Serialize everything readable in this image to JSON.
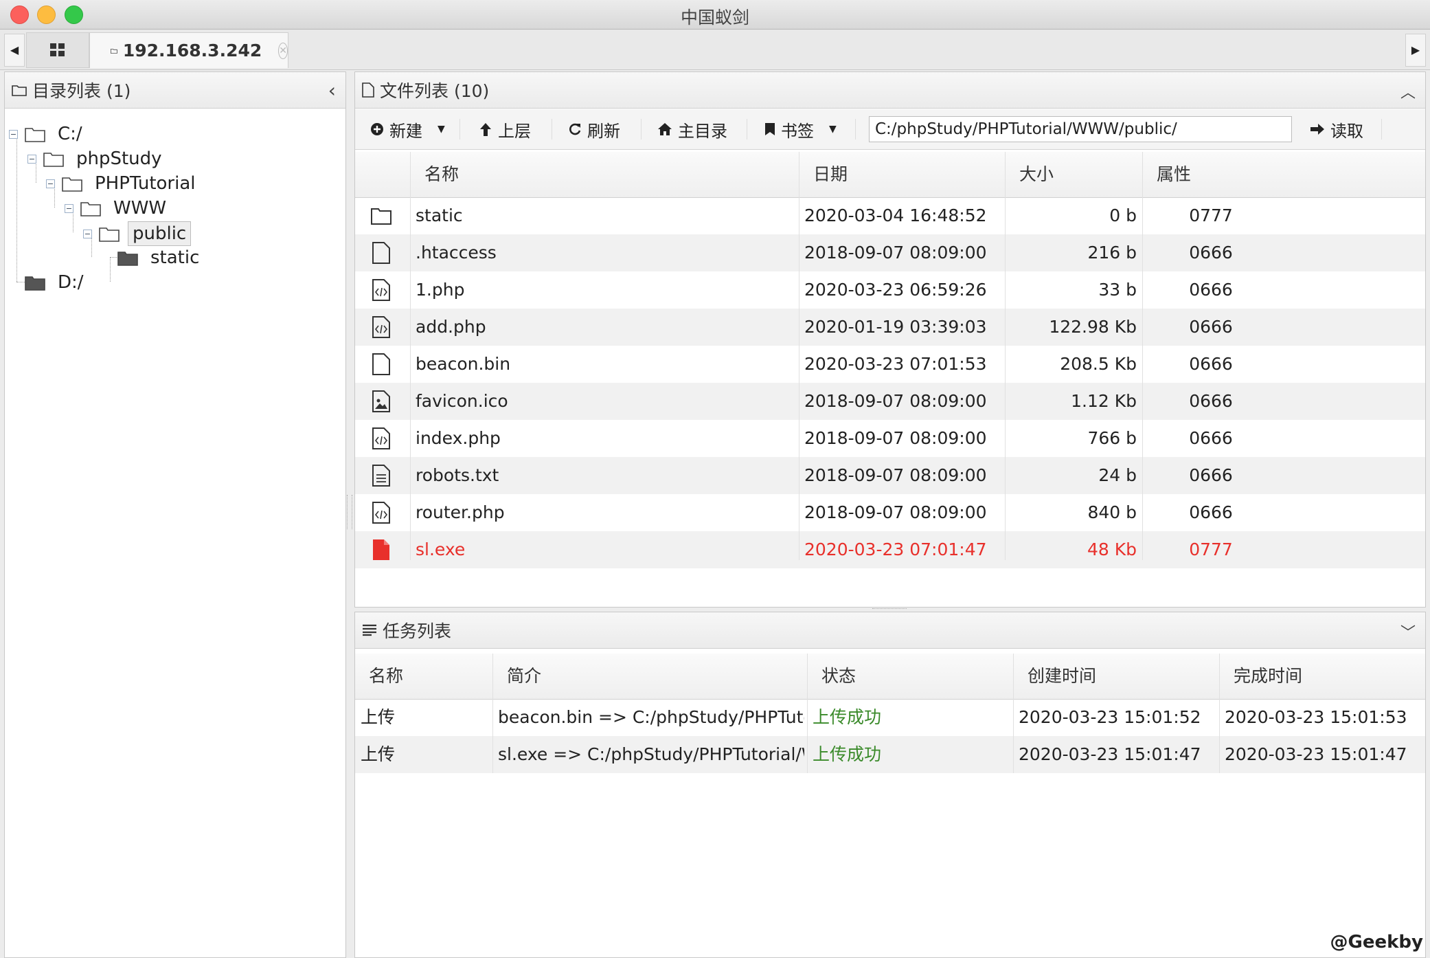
{
  "window": {
    "title": "中国蚁剑"
  },
  "tabs": {
    "active_label": "192.168.3.242"
  },
  "dir_panel": {
    "title": "目录列表 (1)",
    "tree": [
      {
        "label": "C:/"
      },
      {
        "label": "phpStudy"
      },
      {
        "label": "PHPTutorial"
      },
      {
        "label": "WWW"
      },
      {
        "label": "public"
      },
      {
        "label": "static"
      },
      {
        "label": "D:/"
      }
    ]
  },
  "file_panel": {
    "title": "文件列表 (10)",
    "toolbar": {
      "new_label": "新建",
      "up_label": "上层",
      "refresh_label": "刷新",
      "home_label": "主目录",
      "bookmark_label": "书签",
      "path_value": "C:/phpStudy/PHPTutorial/WWW/public/",
      "read_label": "读取"
    },
    "columns": [
      "名称",
      "日期",
      "大小",
      "属性"
    ],
    "rows": [
      {
        "icon": "folder-icon",
        "name": "static",
        "date": "2020-03-04 16:48:52",
        "size": "0 b",
        "attr": "0777"
      },
      {
        "icon": "file-icon",
        "name": ".htaccess",
        "date": "2018-09-07 08:09:00",
        "size": "216 b",
        "attr": "0666"
      },
      {
        "icon": "code-file-icon",
        "name": "1.php",
        "date": "2020-03-23 06:59:26",
        "size": "33 b",
        "attr": "0666"
      },
      {
        "icon": "code-file-icon",
        "name": "add.php",
        "date": "2020-01-19 03:39:03",
        "size": "122.98 Kb",
        "attr": "0666"
      },
      {
        "icon": "file-icon",
        "name": "beacon.bin",
        "date": "2020-03-23 07:01:53",
        "size": "208.5 Kb",
        "attr": "0666"
      },
      {
        "icon": "image-file-icon",
        "name": "favicon.ico",
        "date": "2018-09-07 08:09:00",
        "size": "1.12 Kb",
        "attr": "0666"
      },
      {
        "icon": "code-file-icon",
        "name": "index.php",
        "date": "2018-09-07 08:09:00",
        "size": "766 b",
        "attr": "0666"
      },
      {
        "icon": "text-file-icon",
        "name": "robots.txt",
        "date": "2018-09-07 08:09:00",
        "size": "24 b",
        "attr": "0666"
      },
      {
        "icon": "code-file-icon",
        "name": "router.php",
        "date": "2018-09-07 08:09:00",
        "size": "840 b",
        "attr": "0666"
      },
      {
        "icon": "executable-file-icon",
        "name": "sl.exe",
        "date": "2020-03-23 07:01:47",
        "size": "48 Kb",
        "attr": "0777"
      }
    ]
  },
  "task_panel": {
    "title": "任务列表",
    "columns": [
      "名称",
      "简介",
      "状态",
      "创建时间",
      "完成时间"
    ],
    "rows": [
      {
        "name": "上传",
        "desc": "beacon.bin => C:/phpStudy/PHPTutori",
        "status": "上传成功",
        "created": "2020-03-23 15:01:52",
        "finished": "2020-03-23 15:01:53"
      },
      {
        "name": "上传",
        "desc": "sl.exe => C:/phpStudy/PHPTutorial/WV",
        "status": "上传成功",
        "created": "2020-03-23 15:01:47",
        "finished": "2020-03-23 15:01:47"
      }
    ]
  },
  "watermark": "@Geekby",
  "colors": {
    "danger": "#e8302b",
    "success": "#3a8a2a"
  }
}
